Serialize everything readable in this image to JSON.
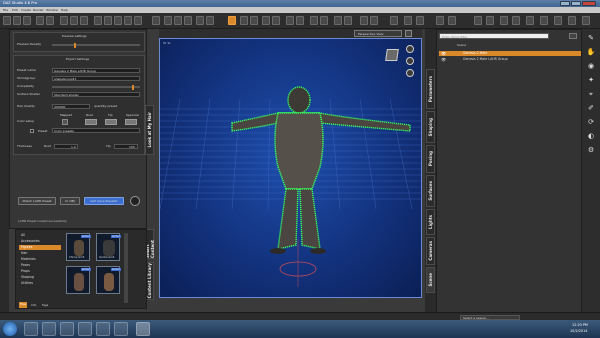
{
  "window": {
    "title": "DAZ Studio 4.6 Pro"
  },
  "menu": [
    "File",
    "Edit",
    "Create",
    "Render",
    "Window",
    "Help"
  ],
  "left_pane": {
    "preview_settings": {
      "header": "Preview settings",
      "preview_density_label": "Preview Density"
    },
    "export_settings": {
      "header": "Export Settings",
      "preset_name_label": "Preset name",
      "preset_name_value": "Genesis 2 Male LAHR Group",
      "shrinkwrap_label": "Shrinkgroup",
      "shrinkwrap_value": "shapeGroup#1",
      "complexity_label": "Complexity",
      "surface_shader_label": "Surface Shader",
      "surface_shader_value": "Standard shader",
      "hair_quality_label": "Hair Quality",
      "hair_quality_value": "400000",
      "hair_quality_unit": "quantity preset"
    },
    "color_setup": {
      "label": "Color setup",
      "columns": [
        "Mapped",
        "Root",
        "Tip",
        "Specular"
      ],
      "preset_label": "Preset",
      "preset_value": "Color presets"
    },
    "thickness": {
      "label": "Thickness",
      "root_label": "Root",
      "root_value": "1.0",
      "tip_label": "Tip",
      "tip_value": "100"
    },
    "buttons": {
      "attach": "Attach LAHR Preset",
      "to_obj": "to OBJ",
      "get_more": "Get more Presets!"
    },
    "status_message": "LAHR Preset loaded successfully"
  },
  "left_tabs": {
    "look_at_my_hair": "Look at My Hair",
    "smart_content": "Smart Content",
    "content_library": "Content Library"
  },
  "content_library": {
    "categories": [
      {
        "label": "All",
        "selected": false
      },
      {
        "label": "Accessories",
        "selected": false
      },
      {
        "label": "Figures",
        "selected": true
      },
      {
        "label": "Hair",
        "selected": false
      },
      {
        "label": "Materials",
        "selected": false
      },
      {
        "label": "Poses",
        "selected": false
      },
      {
        "label": "Props",
        "selected": false
      },
      {
        "label": "Shaping",
        "selected": false
      },
      {
        "label": "Utilities",
        "selected": false
      }
    ],
    "thumbnails": [
      {
        "badge": "Actor",
        "label": "Chimp Gm5"
      },
      {
        "badge": "Actor",
        "label": "Gorilla Gm5"
      },
      {
        "badge": "Actor",
        "label": ""
      },
      {
        "badge": "Actor",
        "label": ""
      }
    ],
    "bottom_tabs": [
      "Files",
      "Info",
      "Tags"
    ]
  },
  "viewport": {
    "camera": "Perspective View",
    "corner_label": "Yo  Yo"
  },
  "right_tabs": [
    "Parameters",
    "Shaping",
    "Posing",
    "Surfaces",
    "Lights",
    "Cameras",
    "Scene"
  ],
  "scene": {
    "search_placeholder": "Enter items filter",
    "column_label": "Scene",
    "rows": [
      {
        "label": "Genesis 2 Male",
        "selected": true
      },
      {
        "label": "Genesis 2 Male LAHR Group",
        "selected": false
      }
    ]
  },
  "statusbar": {
    "lesson_placeholder": "Select a Lesson..."
  },
  "taskbar": {
    "time": "12:20 PM",
    "date": "10/2/2014"
  },
  "colors": {
    "accent": "#d9882a",
    "viewport_bg": "#1e4fae",
    "hair_glow": "#39ff5a"
  }
}
